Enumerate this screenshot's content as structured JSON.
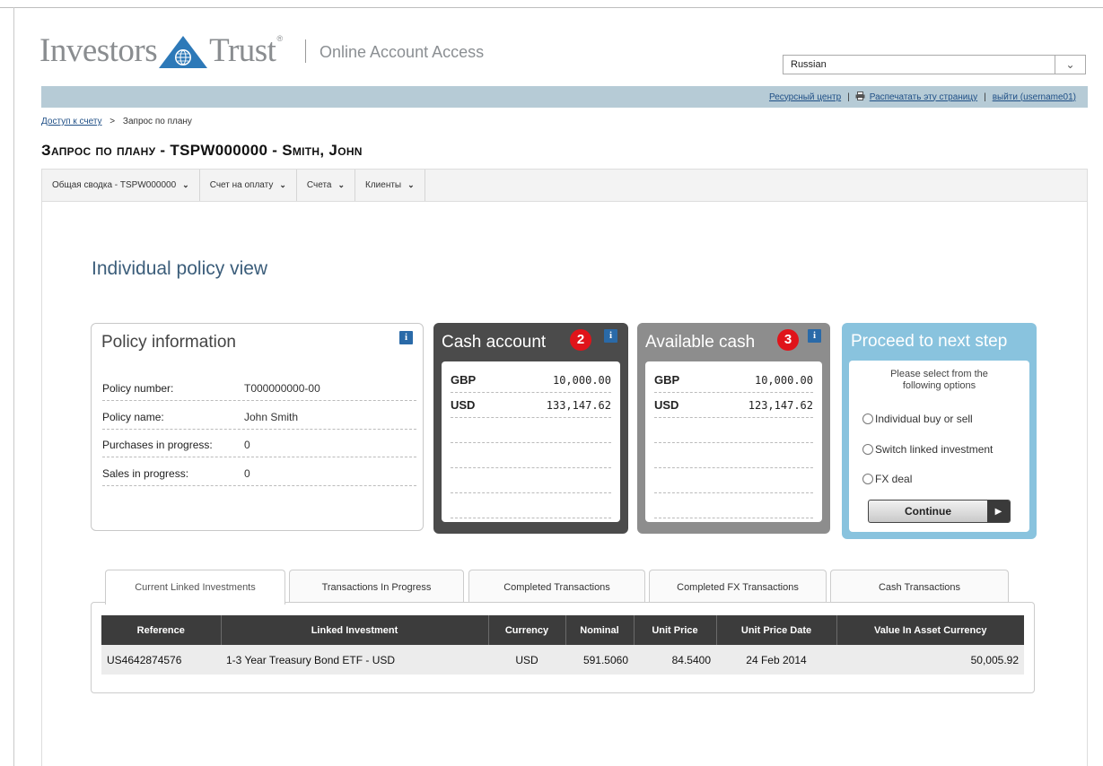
{
  "brand": {
    "logo_left": "Investors",
    "logo_right": "Trust",
    "tm": "®",
    "tagline": "Online Account Access"
  },
  "language": {
    "selected": "Russian"
  },
  "utility": {
    "resource_center": "Ресурсный центр",
    "print": "Распечатать эту страницу",
    "logout": "выйти (username01)"
  },
  "breadcrumb": {
    "root": "Доступ к счету",
    "current": "Запрос по плану"
  },
  "page_title": "Запрос по плану - TSPW000000 - Smith, John",
  "menu": [
    {
      "label": "Общая сводка - TSPW000000"
    },
    {
      "label": "Счет на оплату"
    },
    {
      "label": "Счета"
    },
    {
      "label": "Клиенты"
    }
  ],
  "section_title": "Individual policy view",
  "policy_info": {
    "title": "Policy information",
    "rows": [
      {
        "label": "Policy number:",
        "value": "T000000000-00"
      },
      {
        "label": "Policy name:",
        "value": "John Smith"
      },
      {
        "label": "Purchases in progress:",
        "value": "0"
      },
      {
        "label": "Sales in progress:",
        "value": "0"
      }
    ]
  },
  "cash_account": {
    "title": "Cash account",
    "badge": "2",
    "rows": [
      {
        "currency": "GBP",
        "amount": "10,000.00"
      },
      {
        "currency": "USD",
        "amount": "133,147.62"
      }
    ]
  },
  "available_cash": {
    "title": "Available cash",
    "badge": "3",
    "rows": [
      {
        "currency": "GBP",
        "amount": "10,000.00"
      },
      {
        "currency": "USD",
        "amount": "123,147.62"
      }
    ]
  },
  "proceed": {
    "title": "Proceed to next step",
    "instruction": "Please select from the following options",
    "options": [
      "Individual buy or sell",
      "Switch linked investment",
      "FX deal"
    ],
    "continue_label": "Continue"
  },
  "info_icon_glyph": "i",
  "tabs": [
    "Current Linked Investments",
    "Transactions In Progress",
    "Completed Transactions",
    "Completed FX Transactions",
    "Cash Transactions"
  ],
  "table": {
    "columns": [
      "Reference",
      "Linked Investment",
      "Currency",
      "Nominal",
      "Unit Price",
      "Unit Price Date",
      "Value In Asset Currency"
    ],
    "rows": [
      [
        "US4642874576",
        "1-3 Year Treasury Bond ETF - USD",
        "USD",
        "591.5060",
        "84.5400",
        "24 Feb 2014",
        "50,005.92"
      ]
    ]
  },
  "colors": {
    "util_bar": "#b6cbd6",
    "link": "#1f4f86",
    "cash_dark": "#4b4b4b",
    "cash_gray": "#8d8d8d",
    "proceed": "#89c3de",
    "badge": "#e0141a"
  }
}
